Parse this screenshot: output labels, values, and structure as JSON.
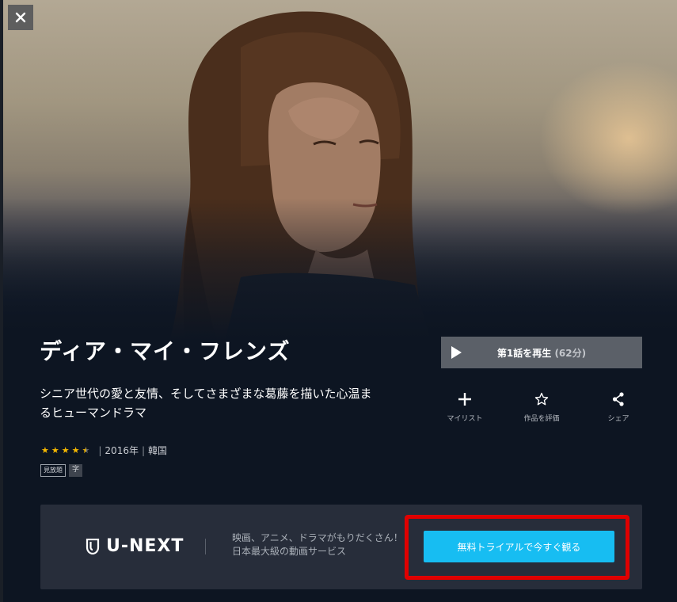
{
  "title": "ディア・マイ・フレンズ",
  "description": "シニア世代の愛と友情、そしてさまざまな葛藤を描いた心温まるヒューマンドラマ",
  "rating": 4.5,
  "year": "2016年",
  "country": "韓国",
  "tags": [
    "見放題",
    "字"
  ],
  "play": {
    "label": "第1話を再生",
    "duration": "(62分)"
  },
  "actions": [
    {
      "icon": "plus-icon",
      "label": "マイリスト"
    },
    {
      "icon": "star-outline-icon",
      "label": "作品を評価"
    },
    {
      "icon": "share-icon",
      "label": "シェア"
    }
  ],
  "promo": {
    "brand": "U-NEXT",
    "line1": "映画、アニメ、ドラマがもりだくさん！",
    "line2": "日本最大級の動画サービス",
    "cta": "無料トライアルで今すぐ観る",
    "highlight_color": "#e00000",
    "cta_color": "#17bdf2"
  },
  "icons": {
    "close": "close-icon",
    "play": "play-icon",
    "brand_logo": "unext-logo-icon"
  }
}
